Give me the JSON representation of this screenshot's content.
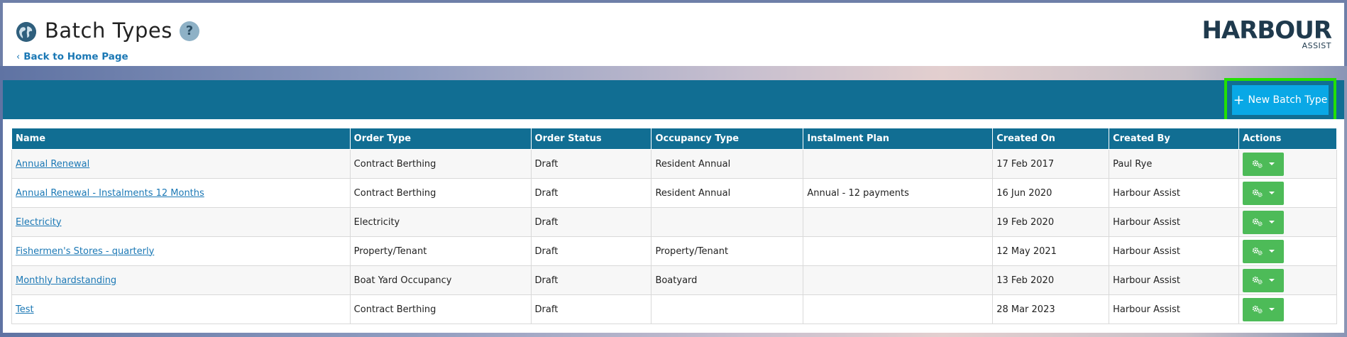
{
  "header": {
    "title": "Batch Types",
    "help_label": "?",
    "back_link": "Back to Home Page",
    "logo_main": "HARBOUR",
    "logo_sub": "ASSIST"
  },
  "toolbar": {
    "new_button_label": "New Batch Type"
  },
  "table": {
    "columns": [
      "Name",
      "Order Type",
      "Order Status",
      "Occupancy Type",
      "Instalment Plan",
      "Created On",
      "Created By",
      "Actions"
    ],
    "rows": [
      {
        "name": "Annual Renewal",
        "order_type": "Contract Berthing",
        "order_status": "Draft",
        "occupancy_type": "Resident Annual",
        "instalment_plan": "",
        "created_on": "17 Feb 2017",
        "created_by": "Paul Rye"
      },
      {
        "name": "Annual Renewal - Instalments 12 Months",
        "order_type": "Contract Berthing",
        "order_status": "Draft",
        "occupancy_type": "Resident Annual",
        "instalment_plan": "Annual - 12 payments",
        "created_on": "16 Jun 2020",
        "created_by": "Harbour Assist"
      },
      {
        "name": "Electricity",
        "order_type": "Electricity",
        "order_status": "Draft",
        "occupancy_type": "",
        "instalment_plan": "",
        "created_on": "19 Feb 2020",
        "created_by": "Harbour Assist"
      },
      {
        "name": "Fishermen's Stores - quarterly",
        "order_type": "Property/Tenant",
        "order_status": "Draft",
        "occupancy_type": "Property/Tenant",
        "instalment_plan": "",
        "created_on": "12 May 2021",
        "created_by": "Harbour Assist"
      },
      {
        "name": "Monthly hardstanding",
        "order_type": "Boat Yard Occupancy",
        "order_status": "Draft",
        "occupancy_type": "Boatyard",
        "instalment_plan": "",
        "created_on": "13 Feb 2020",
        "created_by": "Harbour Assist"
      },
      {
        "name": "Test",
        "order_type": "Contract Berthing",
        "order_status": "Draft",
        "occupancy_type": "",
        "instalment_plan": "",
        "created_on": "28 Mar 2023",
        "created_by": "Harbour Assist"
      }
    ]
  },
  "colors": {
    "header_band": "#116e93",
    "new_button": "#09a8e6",
    "highlight_border": "#22e000",
    "action_button": "#4dbb58",
    "link": "#1b78b5"
  }
}
